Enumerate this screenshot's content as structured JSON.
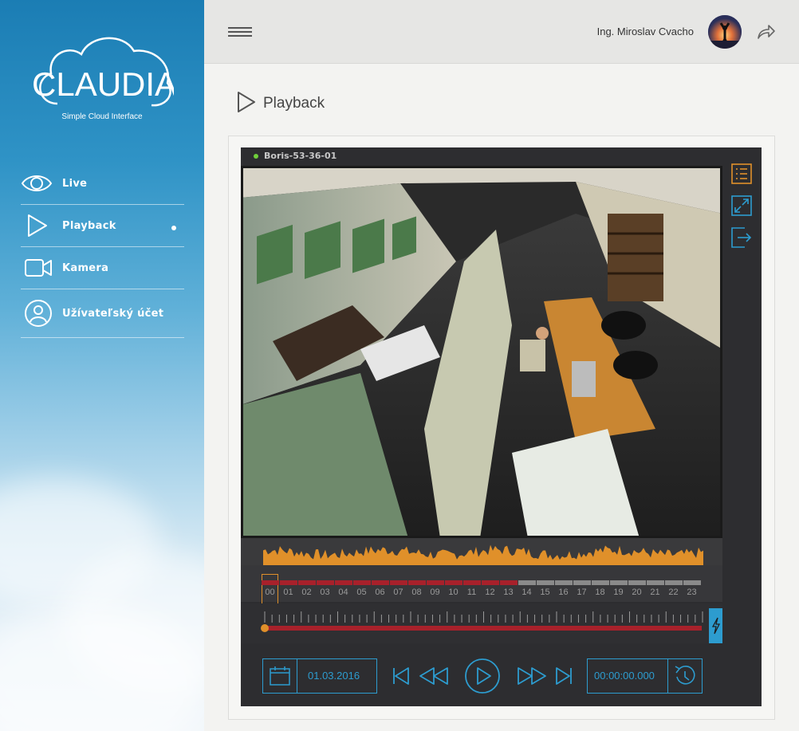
{
  "app": {
    "logo_text": "CLAUDIA",
    "logo_subtitle": "Simple Cloud Interface"
  },
  "sidebar": {
    "items": [
      {
        "label": "Live",
        "icon": "eye-icon",
        "active": false
      },
      {
        "label": "Playback",
        "icon": "play-icon",
        "active": true
      },
      {
        "label": "Kamera",
        "icon": "camera-icon",
        "active": false
      },
      {
        "label": "Užívateľský účet",
        "icon": "user-icon",
        "active": false
      }
    ]
  },
  "header": {
    "user_name": "Ing. Miroslav Cvacho",
    "icons": [
      "hamburger-icon",
      "avatar",
      "logout-icon"
    ]
  },
  "page": {
    "title": "Playback"
  },
  "player": {
    "camera_name": "Boris-53-36-01",
    "camera_status": "online",
    "tools": [
      "list-icon",
      "expand-icon",
      "exit-icon"
    ],
    "hours": [
      "00",
      "01",
      "02",
      "03",
      "04",
      "05",
      "06",
      "07",
      "08",
      "09",
      "10",
      "11",
      "12",
      "13",
      "14",
      "15",
      "16",
      "17",
      "18",
      "19",
      "20",
      "21",
      "22",
      "23"
    ],
    "recorded_hours": 14,
    "selected_hour": "00",
    "playhead_fraction": 0,
    "date": "01.03.2016",
    "time": "00:00:00.000"
  },
  "colors": {
    "accent": "#2d9ccf",
    "recorded": "#a8212b",
    "waveform": "#e0902a",
    "panel": "#2d2d30"
  }
}
